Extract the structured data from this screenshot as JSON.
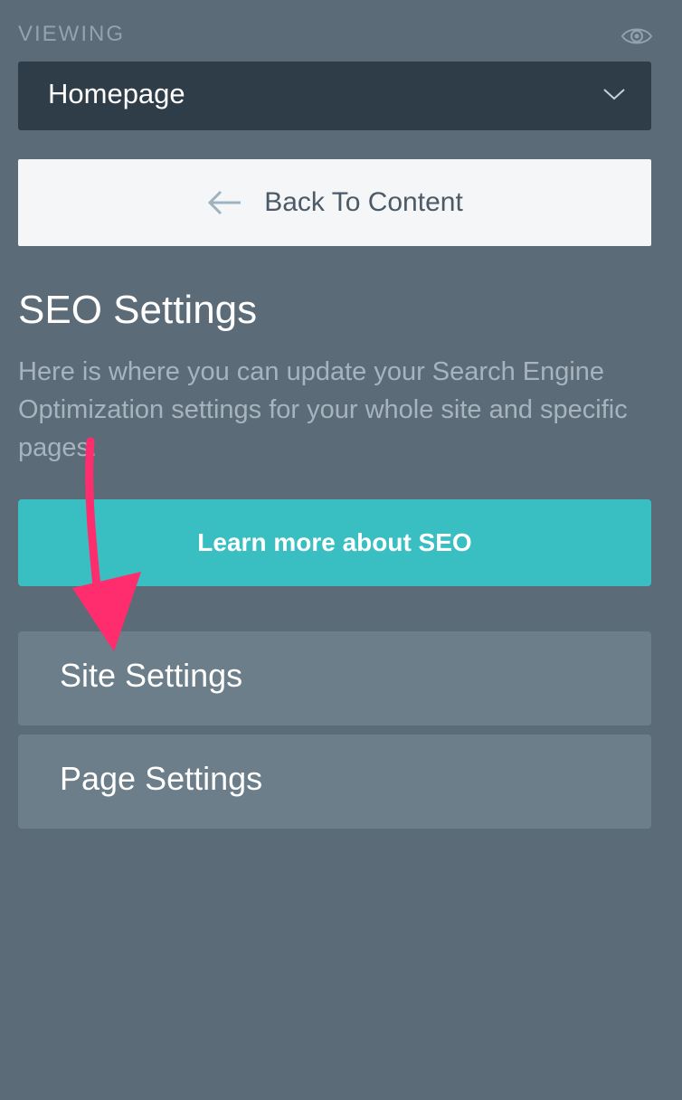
{
  "viewing": {
    "label": "VIEWING",
    "icon": "eye-icon"
  },
  "page_select": {
    "value": "Homepage",
    "icon": "chevron-down-icon"
  },
  "back_button": {
    "label": "Back To Content",
    "icon": "arrow-left-icon"
  },
  "seo": {
    "title": "SEO Settings",
    "description": "Here is where you can update your Search Engine Optimization settings for your whole site and specific pages.",
    "learn_button": "Learn more about SEO"
  },
  "settings_items": [
    {
      "label": "Site Settings"
    },
    {
      "label": "Page Settings"
    }
  ],
  "colors": {
    "background": "#5b6b77",
    "dropdown": "#2e3d48",
    "accent": "#39bec2",
    "item": "#6c7e8a",
    "annotation": "#ff2d6e"
  }
}
